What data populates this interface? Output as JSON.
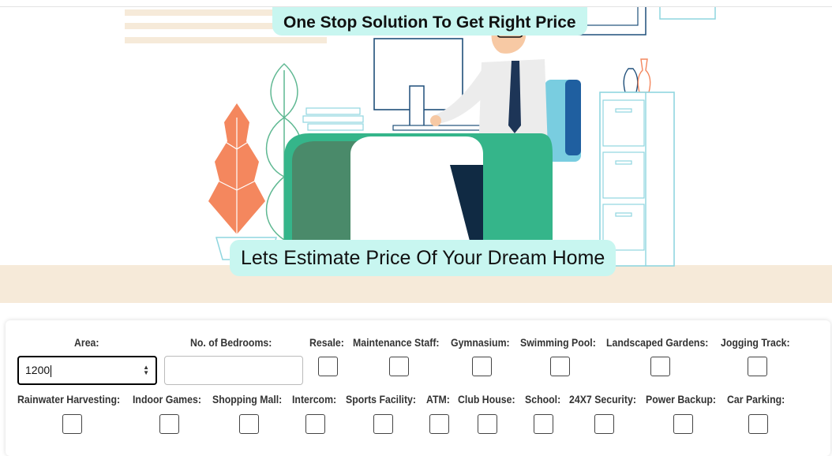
{
  "hero": {
    "tagline": "One Stop Solution To Get Right Price",
    "headline": "Lets Estimate Price Of Your Dream Home"
  },
  "form": {
    "area_label": "Area:",
    "area_value": "1200",
    "bedrooms_label": "No. of Bedrooms:",
    "bedrooms_value": "",
    "row1_checkboxes": [
      {
        "label": "Resale:"
      },
      {
        "label": "Maintenance Staff:"
      },
      {
        "label": "Gymnasium:"
      },
      {
        "label": "Swimming Pool:"
      },
      {
        "label": "Landscaped Gardens:"
      },
      {
        "label": "Jogging Track:"
      }
    ],
    "row2_checkboxes": [
      {
        "label": "Rainwater Harvesting:"
      },
      {
        "label": "Indoor Games:"
      },
      {
        "label": "Shopping Mall:"
      },
      {
        "label": "Intercom:"
      },
      {
        "label": "Sports Facility:"
      },
      {
        "label": "ATM:"
      },
      {
        "label": "Club House:"
      },
      {
        "label": "School:"
      },
      {
        "label": "24X7 Security:"
      },
      {
        "label": "Power Backup:"
      },
      {
        "label": "Car Parking:"
      }
    ]
  },
  "colors": {
    "banner": "#c8f6f0",
    "desk": "#35b58a",
    "desk_dark": "#4a8a6a",
    "plant": "#f4875e",
    "floor": "#f6ead9",
    "line": "#8fd6df"
  }
}
